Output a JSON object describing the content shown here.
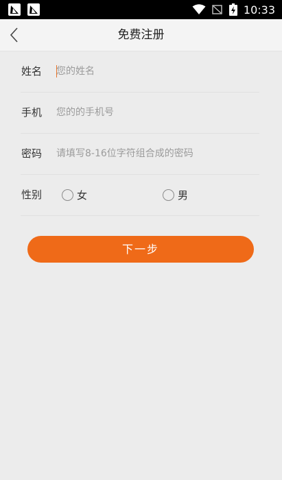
{
  "status_bar": {
    "time": "10:33",
    "icons": [
      "notification-app-icon",
      "notification-app-icon",
      "wifi-icon",
      "no-signal-icon",
      "battery-charging-icon"
    ]
  },
  "nav": {
    "back_icon": "chevron-left-icon",
    "title": "免费注册"
  },
  "form": {
    "name": {
      "label": "姓名",
      "placeholder": "您的姓名"
    },
    "phone": {
      "label": "手机",
      "placeholder": "您的的手机号"
    },
    "password": {
      "label": "密码",
      "placeholder": "请填写8-16位字符组合成的密码"
    },
    "gender": {
      "label": "性别",
      "options": [
        {
          "label": "女",
          "selected": false
        },
        {
          "label": "男",
          "selected": false
        }
      ]
    }
  },
  "next_button": {
    "label": "下一步"
  },
  "colors": {
    "accent": "#ef6a18",
    "background": "#ececec",
    "status_bar": "#000000"
  }
}
